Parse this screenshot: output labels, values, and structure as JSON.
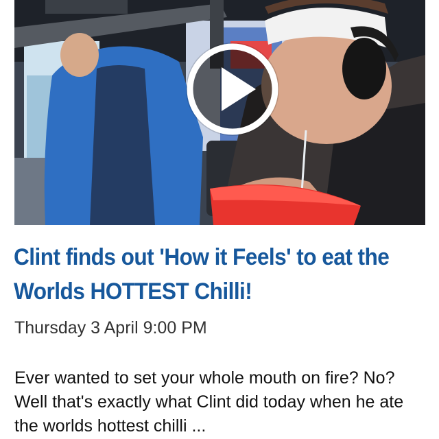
{
  "article": {
    "headline": "Clint finds out 'How it Feels' to eat the Worlds HOTTEST Chilli!",
    "date": "Thursday 3 April 9:00 PM",
    "summary": "Ever wanted to set your whole mouth on fire? No? Well that's exactly what Clint did today when he ate the worlds hottest chilli ..."
  },
  "video": {
    "play_icon": "play-icon",
    "colors": {
      "play_ring": "#ffffff",
      "play_fill": "#111111",
      "bucket": "#e8342e",
      "headband": "#f2f2f2",
      "jacket": "#2f6fc2"
    }
  },
  "colors": {
    "headline": "#17589c",
    "date": "#333333",
    "body_text": "#111111",
    "background": "#ffffff"
  }
}
